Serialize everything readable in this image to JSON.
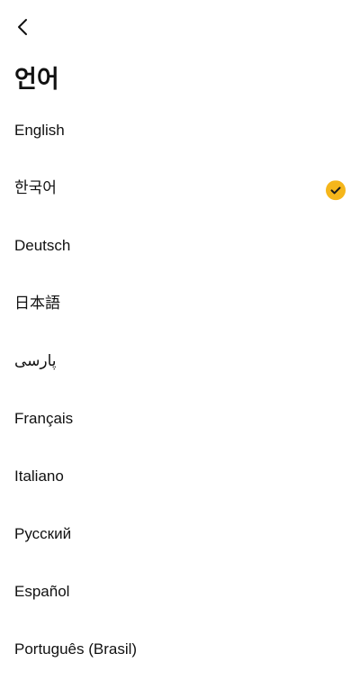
{
  "header": {
    "back_icon": "chevron-left-icon",
    "title": "언어"
  },
  "languages": [
    {
      "label": "English",
      "selected": false
    },
    {
      "label": "한국어",
      "selected": true
    },
    {
      "label": "Deutsch",
      "selected": false
    },
    {
      "label": "日本語",
      "selected": false
    },
    {
      "label": "پارسی",
      "selected": false
    },
    {
      "label": "Français",
      "selected": false
    },
    {
      "label": "Italiano",
      "selected": false
    },
    {
      "label": "Русский",
      "selected": false
    },
    {
      "label": "Español",
      "selected": false
    },
    {
      "label": "Português (Brasil)",
      "selected": false
    }
  ],
  "colors": {
    "accent": "#F5B61B",
    "check_mark": "#1A1A1A",
    "text": "#111111",
    "background": "#FFFFFF"
  }
}
